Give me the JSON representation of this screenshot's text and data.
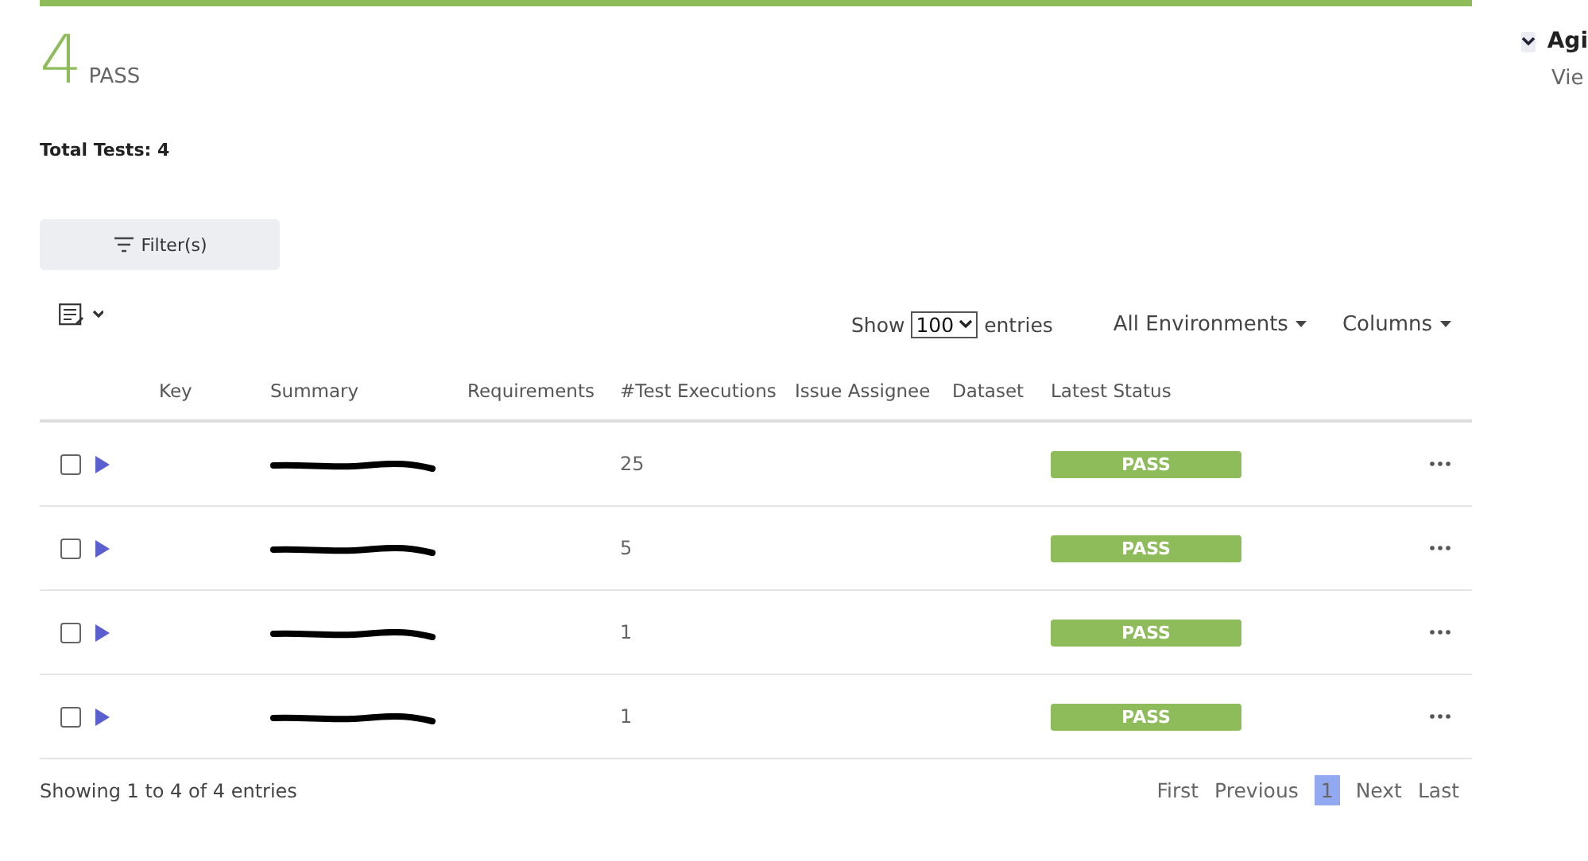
{
  "summary": {
    "count": "4",
    "status": "PASS"
  },
  "total": "Total Tests: 4",
  "filter_button": "Filter(s)",
  "length": {
    "prefix": "Show",
    "value": "100",
    "suffix": "entries"
  },
  "dropdowns": [
    "All Environments",
    "Columns"
  ],
  "table": {
    "columns": [
      "Key",
      "Summary",
      "Requirements",
      "#Test Executions",
      "Issue Assignee",
      "Dataset",
      "Latest Status"
    ],
    "rows": [
      {
        "checked": false,
        "summary_redacted": true,
        "executions": "25",
        "status": "PASS"
      },
      {
        "checked": false,
        "summary_redacted": true,
        "executions": "5",
        "status": "PASS"
      },
      {
        "checked": false,
        "summary_redacted": true,
        "executions": "1",
        "status": "PASS"
      },
      {
        "checked": false,
        "summary_redacted": true,
        "executions": "1",
        "status": "PASS"
      }
    ]
  },
  "info": "Showing 1 to 4 of 4 entries",
  "pagination": [
    {
      "label": "First",
      "selected": false
    },
    {
      "label": "Previous",
      "selected": false
    },
    {
      "label": "1",
      "selected": true
    },
    {
      "label": "Next",
      "selected": false
    },
    {
      "label": "Last",
      "selected": false
    }
  ],
  "side_panel": {
    "title": "Agi",
    "link": "Vie"
  }
}
